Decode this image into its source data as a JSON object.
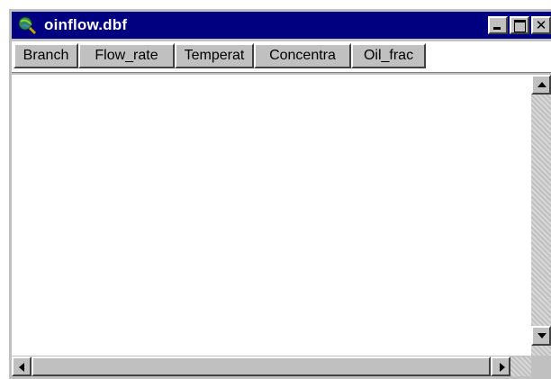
{
  "window": {
    "title": "oinflow.dbf",
    "icon": "globe-magnifier-icon",
    "buttons": {
      "minimize": "minimize-icon",
      "maximize": "maximize-icon",
      "close_glyph": "✕"
    }
  },
  "table": {
    "columns": [
      "Branch",
      "Flow_rate",
      "Temperat",
      "Concentra",
      "Oil_frac"
    ],
    "rows": []
  },
  "colors": {
    "titlebar": "#000080",
    "face": "#c0c0c0",
    "grid_bg": "#ffffff"
  }
}
